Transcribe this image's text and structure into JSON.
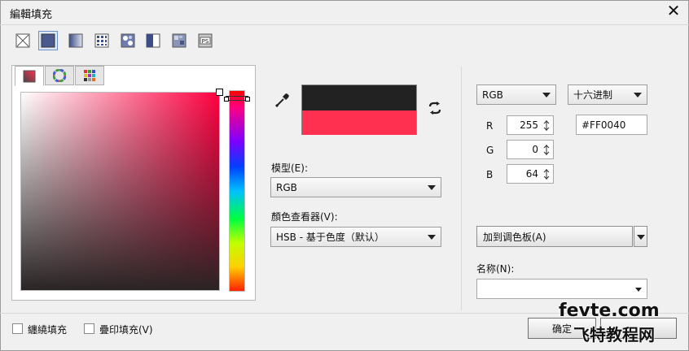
{
  "window": {
    "title": "編輯填充",
    "close_icon": "close-icon"
  },
  "fill_types": [
    {
      "name": "no-fill-icon",
      "selected": false
    },
    {
      "name": "uniform-fill-icon",
      "selected": true
    },
    {
      "name": "fountain-fill-icon",
      "selected": false
    },
    {
      "name": "vector-pattern-icon",
      "selected": false
    },
    {
      "name": "bitmap-pattern-icon",
      "selected": false
    },
    {
      "name": "two-color-pattern-icon",
      "selected": false
    },
    {
      "name": "texture-fill-icon",
      "selected": false
    },
    {
      "name": "postscript-fill-icon",
      "selected": false,
      "label": "PS"
    }
  ],
  "tabs": [
    {
      "name": "tab-models-icon",
      "active": true
    },
    {
      "name": "tab-mixers-icon",
      "active": false
    },
    {
      "name": "tab-palettes-icon",
      "active": false
    }
  ],
  "colors": {
    "current": "#222222",
    "new": "#ff3050",
    "accent": "#ff0040"
  },
  "middle": {
    "model_label": "模型(E):",
    "model_value": "RGB",
    "viewer_label": "顏色查看器(V):",
    "viewer_value": "HSB - 基于色度（默认）"
  },
  "right": {
    "color_model": "RGB",
    "value_format": "十六进制",
    "channels": [
      {
        "label": "R",
        "value": "255"
      },
      {
        "label": "G",
        "value": "0"
      },
      {
        "label": "B",
        "value": "64"
      }
    ],
    "hex_value": "#FF0040",
    "add_to_palette": "加到调色板(A)",
    "name_label": "名称(N):",
    "name_value": ""
  },
  "footer": {
    "wrap_fill": "纏繞填充",
    "overprint_fill": "疊印填充(V)",
    "ok": "确定"
  },
  "watermark": {
    "line1": "fevte.com",
    "line2": "飞特教程网"
  }
}
